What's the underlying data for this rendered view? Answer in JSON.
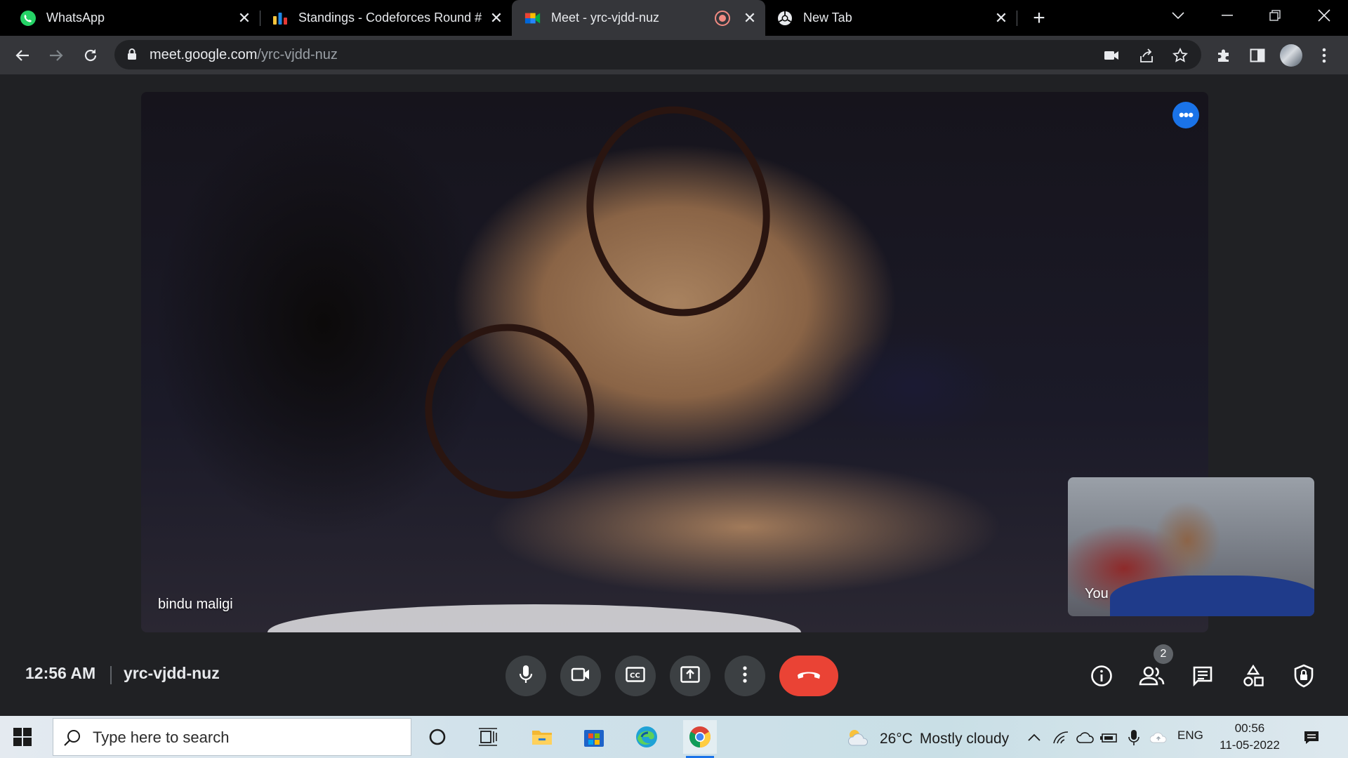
{
  "browser": {
    "tabs": [
      {
        "title": "WhatsApp",
        "icon": "whatsapp-icon",
        "active": false
      },
      {
        "title": "Standings - Codeforces Round #",
        "icon": "codeforces-icon",
        "active": false
      },
      {
        "title": "Meet - yrc-vjdd-nuz",
        "icon": "google-meet-icon",
        "active": true,
        "recording": true
      },
      {
        "title": "New Tab",
        "icon": "chrome-icon",
        "active": false
      }
    ],
    "url_domain": "meet.google.com",
    "url_path": "/yrc-vjdd-nuz"
  },
  "meet": {
    "main_participant": "bindu maligi",
    "self_label": "You",
    "time": "12:56 AM",
    "meeting_code": "yrc-vjdd-nuz",
    "participant_count": "2",
    "accent": "#1a73e8",
    "end_call_color": "#ea4335"
  },
  "taskbar": {
    "search_placeholder": "Type here to search",
    "weather_temp": "26°C",
    "weather_desc": "Mostly cloudy",
    "language": "ENG",
    "clock_time": "00:56",
    "clock_date": "11-05-2022"
  }
}
